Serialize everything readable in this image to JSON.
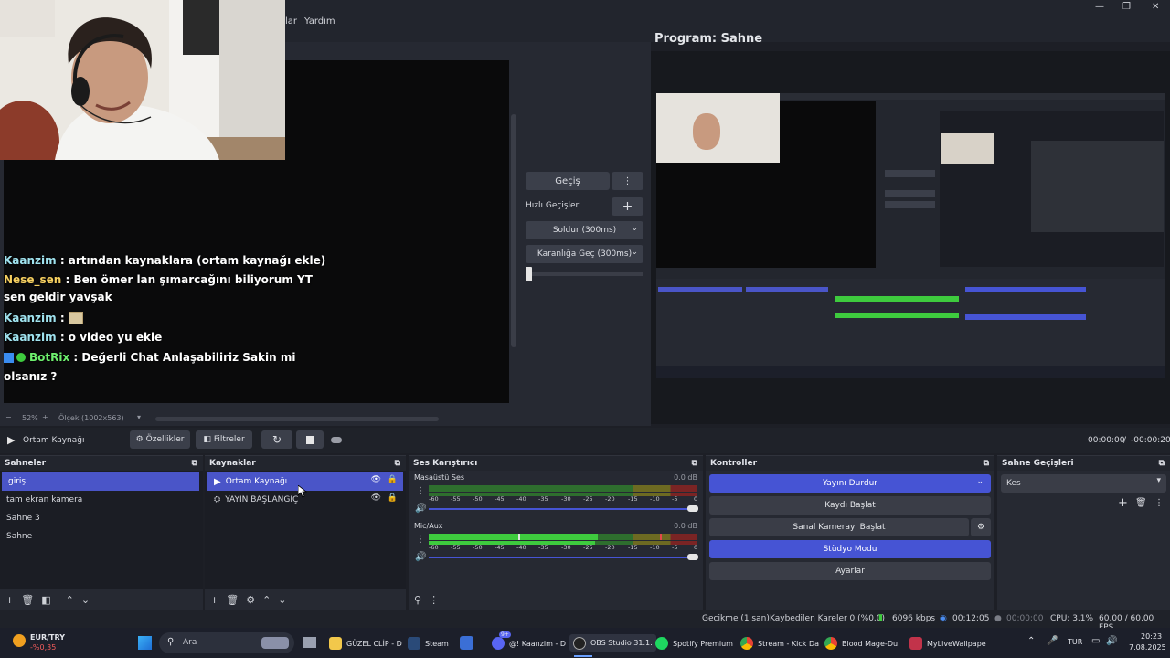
{
  "menu": {
    "partial_item": "lar",
    "help": "Yardım"
  },
  "window_controls": {
    "minimize": "—",
    "maximize": "❐",
    "close": "✕"
  },
  "chat": [
    {
      "user": "Kaanzim",
      "text": " : artından kaynaklara (ortam kaynağı ekle)",
      "cls": "user"
    },
    {
      "user": "Nese_sen",
      "text": " : Ben ömer lan şımarcağını biliyorum YT sen geldir yavşak",
      "cls": "user-n"
    },
    {
      "user": "Kaanzim",
      "text": " : ",
      "cls": "user"
    },
    {
      "user": "Kaanzim",
      "text": " : o video yu ekle",
      "cls": "user"
    },
    {
      "user": "BotRix",
      "text": " : Değerli Chat Anlaşabiliriz Sakin mi olsanız ?",
      "cls": "user-b"
    }
  ],
  "zoom": {
    "minus": "−",
    "percent": "52%",
    "plus": "+",
    "scale": "Ölçek (1002x563)"
  },
  "transitions": {
    "switch_label": "Geçiş",
    "quick_label": "Hızlı Geçişler",
    "fade": "Soldur (300ms)",
    "fade_black": "Karanlığa Geç (300ms)"
  },
  "program": {
    "title": "Program: Sahne"
  },
  "transport": {
    "source": "Ortam Kaynağı",
    "properties": "Özellikler",
    "filters": "Filtreler",
    "time_current": "00:00:00",
    "separator": "/",
    "time_remaining": "-00:00:20"
  },
  "scenes": {
    "title": "Sahneler",
    "items": [
      "giriş",
      "tam ekran kamera",
      "Sahne 3",
      "Sahne"
    ],
    "selected": 0
  },
  "sources": {
    "title": "Kaynaklar",
    "items": [
      "Ortam Kaynağı",
      "YAYIN BAŞLANGIÇ"
    ]
  },
  "mixer": {
    "title": "Ses Karıştırıcı",
    "channels": [
      {
        "name": "Masaüstü Ses",
        "db": "0.0 dB",
        "level": 0.0
      },
      {
        "name": "Mic/Aux",
        "db": "0.0 dB",
        "level": 0.72
      }
    ],
    "ticks": [
      "-60",
      "-55",
      "-50",
      "-45",
      "-40",
      "-35",
      "-30",
      "-25",
      "-20",
      "-15",
      "-10",
      "-5",
      "0"
    ]
  },
  "controls": {
    "title": "Kontroller",
    "stop_stream": "Yayını Durdur",
    "start_record": "Kaydı Başlat",
    "virtual_cam": "Sanal Kamerayı Başlat",
    "studio_mode": "Stüdyo Modu",
    "settings": "Ayarlar"
  },
  "scene_transitions": {
    "title": "Sahne Geçişleri",
    "value": "Kes"
  },
  "status": {
    "delay": "Gecikme (1 san)",
    "dropped": "Kaybedilen Kareler 0 (%0.0)",
    "bitrate": "6096 kbps",
    "stream_time": "00:12:05",
    "record_time": "00:00:00",
    "cpu": "CPU: 3.1%",
    "fps": "60.00 / 60.00 FPS"
  },
  "taskbar": {
    "widget_title": "EUR/TRY",
    "widget_value": "-%0,35",
    "search": "Ara",
    "items": [
      "GÜZEL CLİP - D",
      "Steam",
      "@! Kaanzim - D",
      "OBS Studio 31.1.",
      "Spotify Premium",
      "Stream - Kick Da",
      "Blood Mage-Du",
      "MyLiveWallpape"
    ],
    "lang": "TUR",
    "time": "20:23",
    "date": "7.08.2025",
    "badge": "9+"
  },
  "colors": {
    "accent": "#4654d4",
    "selection": "#4a55c8",
    "meter_green": "#3ecb3e"
  }
}
